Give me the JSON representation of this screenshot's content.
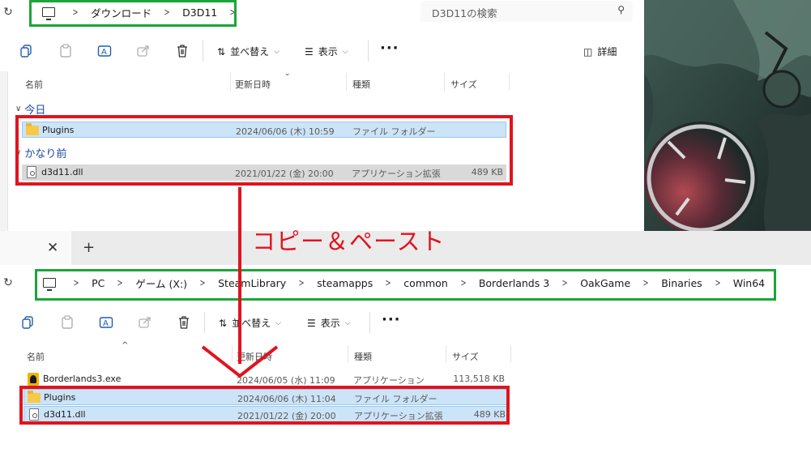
{
  "top": {
    "breadcrumb": [
      "ダウンロード",
      "D3D11"
    ],
    "search_placeholder": "D3D11の検索",
    "toolbar": {
      "sort_label": "並べ替え",
      "view_label": "表示",
      "details_label": "詳細"
    },
    "columns": {
      "name": "名前",
      "modified": "更新日時",
      "type": "種類",
      "size": "サイズ"
    },
    "groups": [
      {
        "label": "今日",
        "files": [
          {
            "name": "Plugins",
            "modified": "2024/06/06 (木) 10:59",
            "type": "ファイル フォルダー",
            "size": "",
            "icon": "folder-icon"
          }
        ]
      },
      {
        "label": "かなり前",
        "files": [
          {
            "name": "d3d11.dll",
            "modified": "2021/01/22 (金) 20:00",
            "type": "アプリケーション拡張",
            "size": "489 KB",
            "icon": "dll-file-icon"
          }
        ]
      }
    ]
  },
  "annotation": {
    "text": "コピー＆ペースト",
    "color": "#e0141e"
  },
  "bottom": {
    "breadcrumb": [
      "PC",
      "ゲーム (X:)",
      "SteamLibrary",
      "steamapps",
      "common",
      "Borderlands 3",
      "OakGame",
      "Binaries",
      "Win64"
    ],
    "toolbar": {
      "sort_label": "並べ替え",
      "view_label": "表示"
    },
    "columns": {
      "name": "名前",
      "modified": "更新日時",
      "type": "種類",
      "size": "サイズ"
    },
    "files": [
      {
        "name": "Borderlands3.exe",
        "modified": "2024/06/05 (水) 11:09",
        "type": "アプリケーション",
        "size": "113,518 KB",
        "icon": "exe-icon"
      },
      {
        "name": "Plugins",
        "modified": "2024/06/06 (木) 11:04",
        "type": "ファイル フォルダー",
        "size": "",
        "icon": "folder-icon"
      },
      {
        "name": "d3d11.dll",
        "modified": "2021/01/22 (金) 20:00",
        "type": "アプリケーション拡張",
        "size": "489 KB",
        "icon": "dll-file-icon"
      }
    ]
  },
  "colors": {
    "highlight_red": "#e0141e",
    "highlight_green": "#1ca53a",
    "selection": "#cce4f7"
  }
}
